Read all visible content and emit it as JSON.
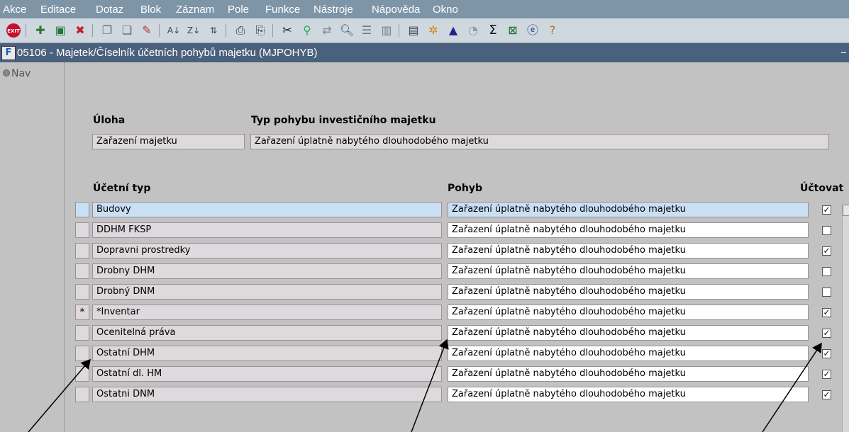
{
  "menu": [
    {
      "label": "Akce"
    },
    {
      "label": "Editace"
    },
    {
      "label": "Dotaz"
    },
    {
      "label": "Blok"
    },
    {
      "label": "Záznam"
    },
    {
      "label": "Pole"
    },
    {
      "label": "Funkce"
    },
    {
      "label": "Nástroje"
    },
    {
      "label": "Nápověda"
    },
    {
      "label": "Okno"
    }
  ],
  "toolbar": {
    "icons": [
      "exit-icon",
      "new-record-icon",
      "save-icon",
      "delete-record-icon",
      "copy-icon",
      "paste-icon",
      "clear-icon",
      "sort-asc-icon",
      "sort-desc-icon",
      "multi-sort-icon",
      "print-icon",
      "print-preview-icon",
      "cut-icon",
      "find-icon",
      "replace-icon",
      "search-icon",
      "align-icon",
      "columns-icon",
      "export-icon",
      "tools-icon",
      "chart-icon",
      "calc-icon",
      "sum-icon",
      "excel-icon",
      "browser-icon",
      "help-icon"
    ]
  },
  "window": {
    "title": "05106 - Majetek/Číselník účetních pohybů majetku (MJPOHYB)"
  },
  "nav": {
    "label": "Nav"
  },
  "header": {
    "uloha_label": "Úloha",
    "typ_label": "Typ pohybu investičního majetku",
    "uloha_value": "Zařazení majetku",
    "typ_value": "Zařazení úplatně nabytého dlouhodobého majetku"
  },
  "grid": {
    "col_ucetni_typ": "Účetní typ",
    "col_pohyb": "Pohyb",
    "col_uctovat": "Účtovat",
    "rows": [
      {
        "mark": "",
        "ucetni_typ": "Budovy",
        "pohyb": "Zařazení úplatně nabytého dlouhodobého majetku",
        "uctovat": true
      },
      {
        "mark": "",
        "ucetni_typ": "DDHM FKSP",
        "pohyb": "Zařazení úplatně nabytého dlouhodobého majetku",
        "uctovat": false
      },
      {
        "mark": "",
        "ucetni_typ": "Dopravni prostredky",
        "pohyb": "Zařazení úplatně nabytého dlouhodobého majetku",
        "uctovat": true
      },
      {
        "mark": "",
        "ucetni_typ": "Drobny DHM",
        "pohyb": "Zařazení úplatně nabytého dlouhodobého majetku",
        "uctovat": false
      },
      {
        "mark": "",
        "ucetni_typ": "Drobný DNM",
        "pohyb": "Zařazení úplatně nabytého dlouhodobého majetku",
        "uctovat": false
      },
      {
        "mark": "*",
        "ucetni_typ": "*Inventar",
        "pohyb": "Zařazení úplatně nabytého dlouhodobého majetku",
        "uctovat": true
      },
      {
        "mark": "",
        "ucetni_typ": "Ocenitelná práva",
        "pohyb": "Zařazení úplatně nabytého dlouhodobého majetku",
        "uctovat": true
      },
      {
        "mark": "",
        "ucetni_typ": "Ostatní DHM",
        "pohyb": "Zařazení úplatně nabytého dlouhodobého majetku",
        "uctovat": true
      },
      {
        "mark": "",
        "ucetni_typ": "Ostatní dl. HM",
        "pohyb": "Zařazení úplatně nabytého dlouhodobého majetku",
        "uctovat": true
      },
      {
        "mark": "",
        "ucetni_typ": "Ostatni DNM",
        "pohyb": "Zařazení úplatně nabytého dlouhodobého majetku",
        "uctovat": true
      }
    ]
  }
}
